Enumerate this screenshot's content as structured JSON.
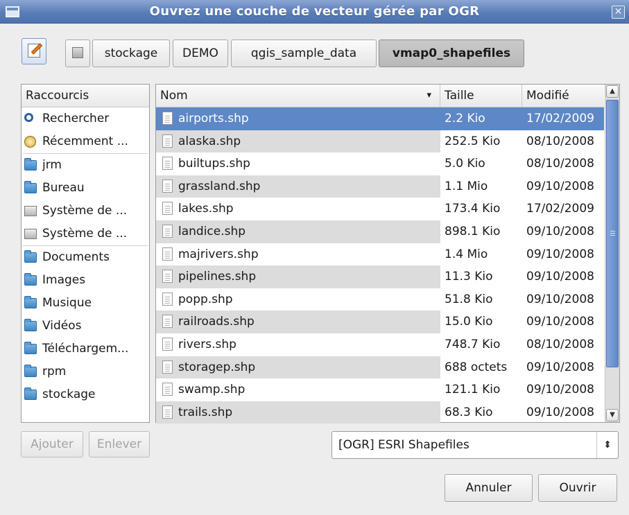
{
  "window": {
    "title": "Ouvrez une couche de vecteur gérée par OGR",
    "close_glyph": "✕"
  },
  "pathbar": {
    "crumbs": [
      "stockage",
      "DEMO",
      "qgis_sample_data",
      "vmap0_shapefiles"
    ],
    "active_crumb": "vmap0_shapefiles"
  },
  "shortcuts": {
    "header": "Raccourcis",
    "items": [
      {
        "label": "Rechercher",
        "icon": "search-icon"
      },
      {
        "label": "Récemment ...",
        "icon": "recent-icon"
      },
      {
        "label": "jrm",
        "icon": "home-folder-icon"
      },
      {
        "label": "Bureau",
        "icon": "desktop-folder-icon"
      },
      {
        "label": "Système de ...",
        "icon": "drive-icon"
      },
      {
        "label": "Système de ...",
        "icon": "drive-icon"
      },
      {
        "label": "Documents",
        "icon": "documents-folder-icon"
      },
      {
        "label": "Images",
        "icon": "pictures-folder-icon"
      },
      {
        "label": "Musique",
        "icon": "music-folder-icon"
      },
      {
        "label": "Vidéos",
        "icon": "videos-folder-icon"
      },
      {
        "label": "Téléchargem...",
        "icon": "downloads-folder-icon"
      },
      {
        "label": "rpm",
        "icon": "folder-icon"
      },
      {
        "label": "stockage",
        "icon": "folder-icon"
      }
    ]
  },
  "filelist": {
    "columns": {
      "name": "Nom",
      "size": "Taille",
      "modified": "Modifié"
    },
    "sort_glyph": "▾",
    "selected_index": 0,
    "rows": [
      {
        "name": "airports.shp",
        "size": "2.2 Kio",
        "modified": "17/02/2009"
      },
      {
        "name": "alaska.shp",
        "size": "252.5 Kio",
        "modified": "08/10/2008"
      },
      {
        "name": "builtups.shp",
        "size": "5.0 Kio",
        "modified": "08/10/2008"
      },
      {
        "name": "grassland.shp",
        "size": "1.1 Mio",
        "modified": "09/10/2008"
      },
      {
        "name": "lakes.shp",
        "size": "173.4 Kio",
        "modified": "17/02/2009"
      },
      {
        "name": "landice.shp",
        "size": "898.1 Kio",
        "modified": "09/10/2008"
      },
      {
        "name": "majrivers.shp",
        "size": "1.4 Mio",
        "modified": "09/10/2008"
      },
      {
        "name": "pipelines.shp",
        "size": "11.3 Kio",
        "modified": "09/10/2008"
      },
      {
        "name": "popp.shp",
        "size": "51.8 Kio",
        "modified": "09/10/2008"
      },
      {
        "name": "railroads.shp",
        "size": "15.0 Kio",
        "modified": "09/10/2008"
      },
      {
        "name": "rivers.shp",
        "size": "748.7 Kio",
        "modified": "08/10/2008"
      },
      {
        "name": "storagep.shp",
        "size": "688 octets",
        "modified": "09/10/2008"
      },
      {
        "name": "swamp.shp",
        "size": "121.1 Kio",
        "modified": "09/10/2008"
      },
      {
        "name": "trails.shp",
        "size": "68.3 Kio",
        "modified": "09/10/2008"
      }
    ]
  },
  "buttons": {
    "add": "Ajouter",
    "remove": "Enlever",
    "cancel": "Annuler",
    "open": "Ouvrir"
  },
  "filter": {
    "selected": "[OGR] ESRI Shapefiles",
    "arrow_glyph": "⬍"
  },
  "colors": {
    "title_bar": "#5a7db8",
    "selection": "#5d87c6"
  }
}
